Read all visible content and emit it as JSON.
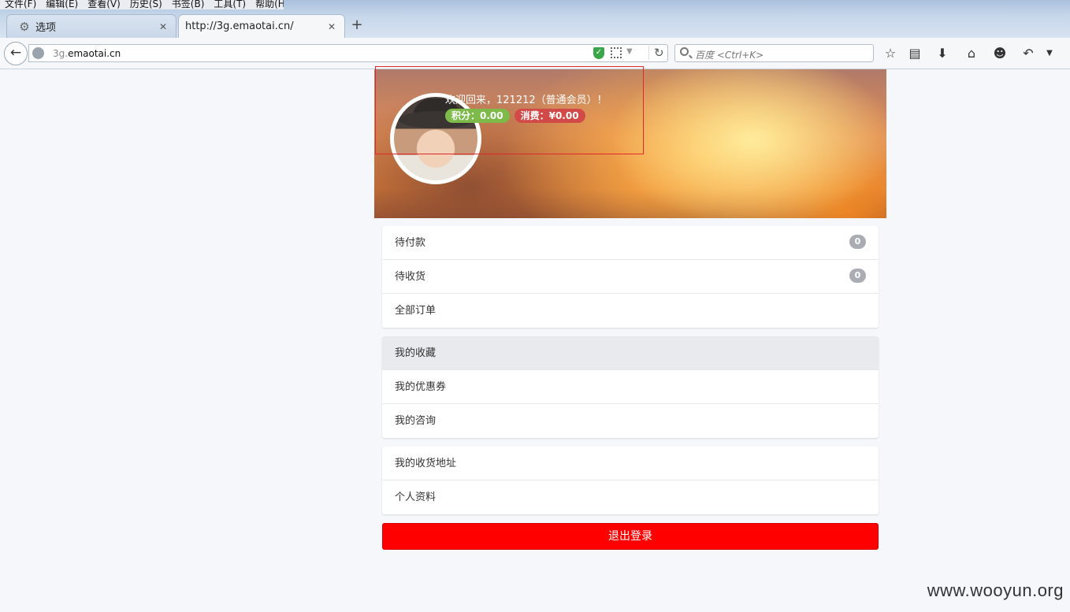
{
  "browser": {
    "menu": [
      "文件(F)",
      "编辑(E)",
      "查看(V)",
      "历史(S)",
      "书签(B)",
      "工具(T)",
      "帮助(H)"
    ],
    "tabs": [
      {
        "title": "选项",
        "icon": "gear-icon",
        "active": false
      },
      {
        "title": "http://3g.emaotai.cn/",
        "active": true
      }
    ],
    "url_prefix": "3g.",
    "url_domain": "emaotai.cn",
    "search_placeholder": "百度 <Ctrl+K>"
  },
  "profile": {
    "welcome": "欢迎回来，121212（普通会员）！",
    "points": "积分：0.00",
    "spent": "消费：¥0.00",
    "accent_colors": {
      "points": "#7dba4a",
      "spent": "#d24a47"
    }
  },
  "menu_groups": [
    {
      "items": [
        {
          "label": "待付款",
          "count": "0"
        },
        {
          "label": "待收货",
          "count": "0"
        },
        {
          "label": "全部订单"
        }
      ]
    },
    {
      "items": [
        {
          "label": "我的收藏"
        },
        {
          "label": "我的优惠券"
        },
        {
          "label": "我的咨询"
        }
      ]
    },
    {
      "items": [
        {
          "label": "我的收货地址"
        },
        {
          "label": "个人资料"
        }
      ]
    }
  ],
  "logout_label": "退出登录",
  "logout_color": "#ff0000",
  "watermark": "www.wooyun.org"
}
